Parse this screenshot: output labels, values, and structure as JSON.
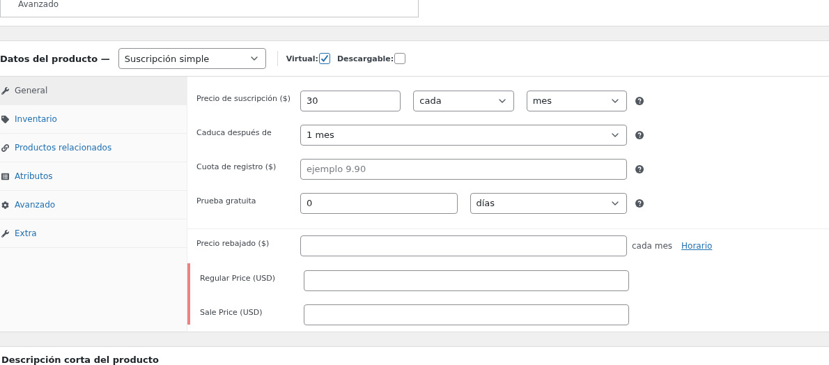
{
  "top_panel": {
    "item": "Avanzado"
  },
  "product_data": {
    "title": "Datos del producto —",
    "type_select": "Suscripción simple",
    "options": [
      {
        "label": "Virtual:",
        "checked": true
      },
      {
        "label": "Descargable:",
        "checked": false
      }
    ]
  },
  "tabs": [
    {
      "label": "General",
      "kind": "wrench",
      "selected": true
    },
    {
      "label": "Inventario",
      "kind": "tag",
      "selected": false
    },
    {
      "label": "Productos relacionados",
      "kind": "link",
      "selected": false
    },
    {
      "label": "Atributos",
      "kind": "list",
      "selected": false
    },
    {
      "label": "Avanzado",
      "kind": "gear",
      "selected": false
    },
    {
      "label": "Extra",
      "kind": "wrench",
      "selected": false
    }
  ],
  "fields": [
    {
      "label": "Precio de suscripción ($)",
      "help": true,
      "controls": [
        {
          "kind": "input",
          "value": "30"
        },
        {
          "kind": "select",
          "value": "cada"
        },
        {
          "kind": "select",
          "value": "mes"
        }
      ]
    },
    {
      "label": "Caduca después de",
      "help": true,
      "controls": [
        {
          "kind": "select",
          "value": "1 mes"
        }
      ]
    },
    {
      "label": "Cuota de registro ($)",
      "help": true,
      "controls": [
        {
          "kind": "input",
          "placeholder": "ejemplo 9.90"
        }
      ]
    },
    {
      "label": "Prueba gratuita",
      "help": true,
      "controls": [
        {
          "kind": "input",
          "value": "0"
        },
        {
          "kind": "select",
          "value": "días"
        }
      ]
    }
  ],
  "sale_price": {
    "label": "Precio rebajado ($)",
    "suffix": "cada mes",
    "link": "Horario"
  },
  "currency_prices": [
    {
      "label": "Regular Price (USD)"
    },
    {
      "label": "Sale Price (USD)"
    }
  ],
  "next_section": {
    "title": "Descripción corta del producto"
  }
}
